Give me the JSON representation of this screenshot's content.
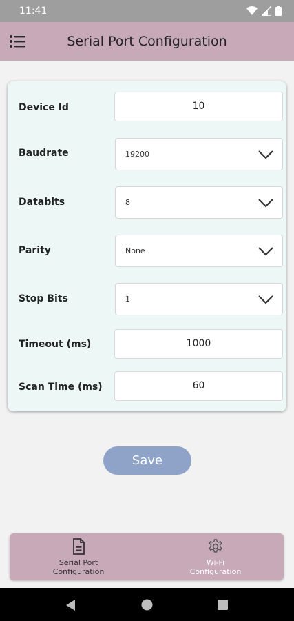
{
  "status_bar": {
    "time": "11:41"
  },
  "app_bar": {
    "title": "Serial Port Configuration"
  },
  "form": {
    "device_id": {
      "label": "Device Id",
      "value": "10"
    },
    "baudrate": {
      "label": "Baudrate",
      "value": "19200"
    },
    "databits": {
      "label": "Databits",
      "value": "8"
    },
    "parity": {
      "label": "Parity",
      "value": "None"
    },
    "stop_bits": {
      "label": "Stop Bits",
      "value": "1"
    },
    "timeout": {
      "label": "Timeout (ms)",
      "value": "1000"
    },
    "scan_time": {
      "label": "Scan Time (ms)",
      "value": "60"
    }
  },
  "save_button": {
    "label": "Save"
  },
  "bottom_nav": {
    "items": [
      {
        "label": "Serial Port\nConfiguration",
        "icon": "document-icon",
        "active": true
      },
      {
        "label": "Wi-Fi\nConfiguration",
        "icon": "gear-icon",
        "active": false
      }
    ]
  },
  "colors": {
    "app_bar": "#c8a9b8",
    "card_background": "#ecf7f6",
    "save_button": "#8fa2c8",
    "background": "#f2f2f2"
  }
}
